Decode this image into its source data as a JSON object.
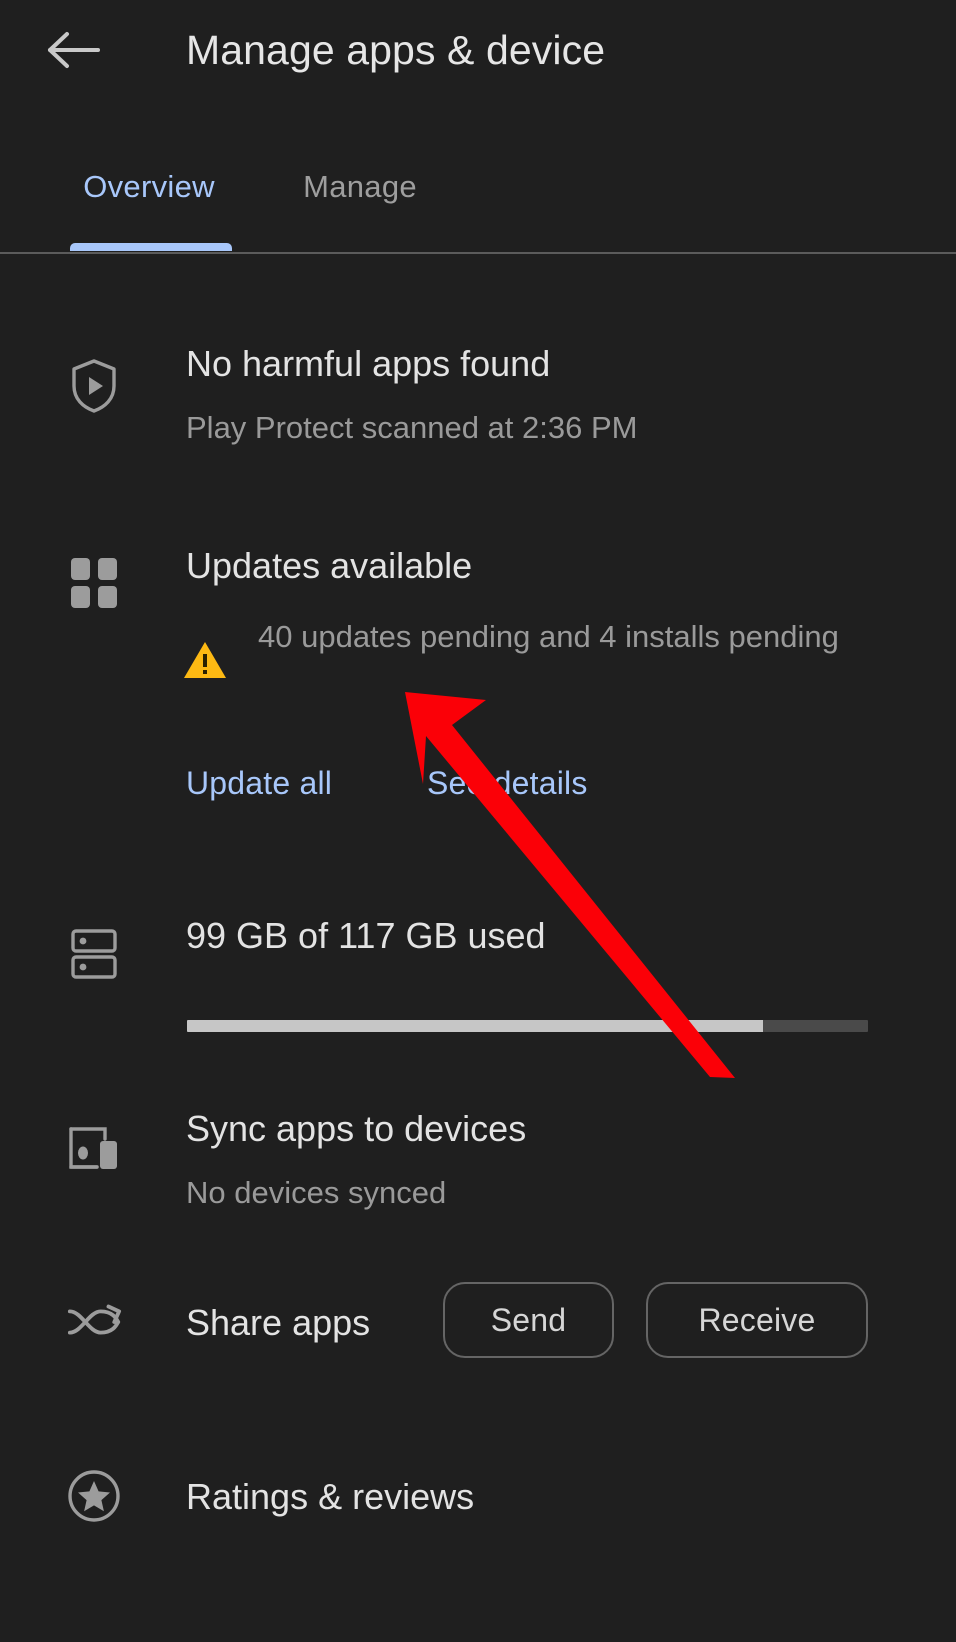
{
  "header": {
    "title": "Manage apps & device",
    "back_icon": "arrow-back-icon"
  },
  "tabs": [
    {
      "label": "Overview",
      "active": true
    },
    {
      "label": "Manage",
      "active": false
    }
  ],
  "sections": {
    "play_protect": {
      "icon": "shield-play-icon",
      "title": "No harmful apps found",
      "subtitle": "Play Protect scanned at 2:36 PM"
    },
    "updates": {
      "icon": "apps-grid-icon",
      "warning_icon": "warning-triangle-icon",
      "title": "Updates available",
      "subtitle": "40 updates pending and 4 installs pending",
      "update_all_label": "Update all",
      "see_details_label": "See details"
    },
    "storage": {
      "icon": "storage-icon",
      "title": "99 GB of 117 GB used",
      "used_gb": 99,
      "total_gb": 117,
      "percent_used": 84.6
    },
    "sync": {
      "icon": "devices-icon",
      "title": "Sync apps to devices",
      "subtitle": "No devices synced"
    },
    "share": {
      "icon": "share-apps-icon",
      "title": "Share apps",
      "send_label": "Send",
      "receive_label": "Receive"
    },
    "ratings": {
      "icon": "star-circle-icon",
      "title": "Ratings & reviews"
    }
  },
  "annotation": {
    "type": "arrow",
    "color": "#fb0007"
  },
  "colors": {
    "background": "#1f1f1f",
    "accent_blue": "#a8c7fa",
    "warning_amber": "#fdb913",
    "text_primary": "#e3e3e3",
    "text_secondary": "#9a9a9a",
    "progress_fill": "#c6c6c6",
    "progress_track": "#4a4a4a"
  }
}
